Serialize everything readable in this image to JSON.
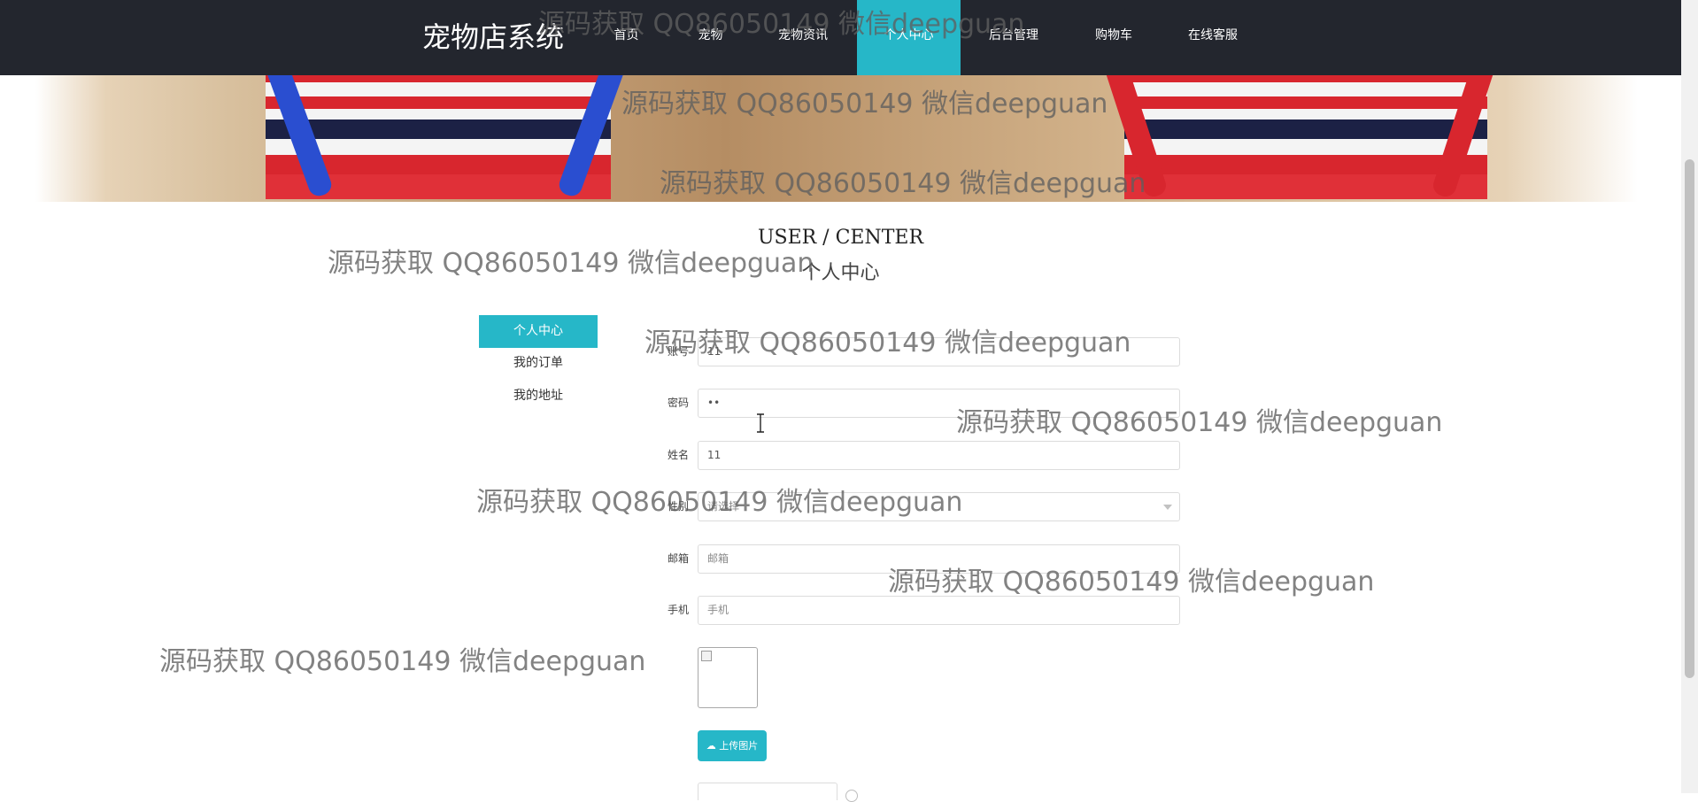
{
  "app": {
    "title": "宠物店系统"
  },
  "nav": {
    "items": [
      {
        "label": "首页",
        "active": false
      },
      {
        "label": "宠物",
        "active": false
      },
      {
        "label": "宠物资讯",
        "active": false
      },
      {
        "label": "个人中心",
        "active": true
      },
      {
        "label": "后台管理",
        "active": false
      },
      {
        "label": "购物车",
        "active": false
      },
      {
        "label": "在线客服",
        "active": false
      }
    ]
  },
  "banner": {
    "image": "pet-photo-striped-clothes"
  },
  "section": {
    "title_en": "USER / CENTER",
    "title_cn": "个人中心"
  },
  "sidebar": {
    "items": [
      {
        "label": "个人中心",
        "active": true
      },
      {
        "label": "我的订单",
        "active": false
      },
      {
        "label": "我的地址",
        "active": false
      }
    ]
  },
  "form": {
    "account": {
      "label": "账号",
      "value": "11"
    },
    "password": {
      "label": "密码",
      "value": "••"
    },
    "name": {
      "label": "姓名",
      "value": "11"
    },
    "gender": {
      "label": "性别",
      "placeholder": "请选择"
    },
    "email": {
      "label": "邮箱",
      "placeholder": "邮箱"
    },
    "phone": {
      "label": "手机",
      "placeholder": "手机"
    },
    "upload_button": "上传图片"
  },
  "watermark": {
    "text": "源码获取 QQ86050149 微信deepguan"
  },
  "colors": {
    "accent": "#26b7c8",
    "nav_bg": "#23262e"
  }
}
